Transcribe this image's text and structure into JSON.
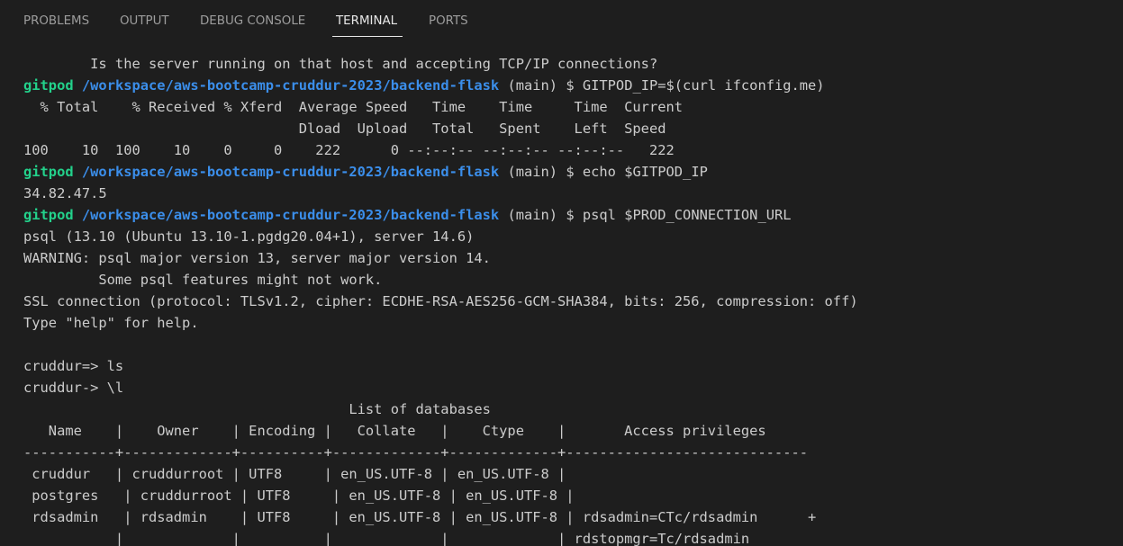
{
  "tabs": [
    {
      "label": "PROBLEMS",
      "active": false
    },
    {
      "label": "OUTPUT",
      "active": false
    },
    {
      "label": "DEBUG CONSOLE",
      "active": false
    },
    {
      "label": "TERMINAL",
      "active": true
    },
    {
      "label": "PORTS",
      "active": false
    }
  ],
  "colors": {
    "background": "#1e1e1e",
    "text": "#cccccc",
    "prompt_user": "#23d18b",
    "prompt_path": "#3b8eea",
    "tab_inactive": "#9d9d9d",
    "tab_active": "#e7e7e7"
  },
  "terminal": {
    "lines": [
      {
        "text": "        Is the server running on that host and accepting TCP/IP connections?"
      },
      {
        "prompt": {
          "user": "gitpod",
          "path": "/workspace/aws-bootcamp-cruddur-2023/backend-flask",
          "rest": " (main) $ GITPOD_IP=$(curl ifconfig.me)"
        }
      },
      {
        "text": "  % Total    % Received % Xferd  Average Speed   Time    Time     Time  Current"
      },
      {
        "text": "                                 Dload  Upload   Total   Spent    Left  Speed"
      },
      {
        "text": "100    10  100    10    0     0    222      0 --:--:-- --:--:-- --:--:--   222"
      },
      {
        "prompt": {
          "user": "gitpod",
          "path": "/workspace/aws-bootcamp-cruddur-2023/backend-flask",
          "rest": " (main) $ echo $GITPOD_IP"
        }
      },
      {
        "text": "34.82.47.5"
      },
      {
        "prompt": {
          "user": "gitpod",
          "path": "/workspace/aws-bootcamp-cruddur-2023/backend-flask",
          "rest": " (main) $ psql $PROD_CONNECTION_URL"
        }
      },
      {
        "text": "psql (13.10 (Ubuntu 13.10-1.pgdg20.04+1), server 14.6)"
      },
      {
        "text": "WARNING: psql major version 13, server major version 14."
      },
      {
        "text": "         Some psql features might not work."
      },
      {
        "text": "SSL connection (protocol: TLSv1.2, cipher: ECDHE-RSA-AES256-GCM-SHA384, bits: 256, compression: off)"
      },
      {
        "text": "Type \"help\" for help."
      },
      {
        "text": ""
      },
      {
        "text": "cruddur=> ls"
      },
      {
        "text": "cruddur-> \\l"
      },
      {
        "text": "                                       List of databases"
      },
      {
        "text": "   Name    |    Owner    | Encoding |   Collate   |    Ctype    |       Access privileges"
      },
      {
        "text": "-----------+-------------+----------+-------------+-------------+-----------------------------"
      },
      {
        "text": " cruddur   | cruddurroot | UTF8     | en_US.UTF-8 | en_US.UTF-8 |"
      },
      {
        "text": " postgres   | cruddurroot | UTF8     | en_US.UTF-8 | en_US.UTF-8 |"
      },
      {
        "text": " rdsadmin   | rdsadmin    | UTF8     | en_US.UTF-8 | en_US.UTF-8 | rdsadmin=CTc/rdsadmin      +"
      },
      {
        "text": "           |             |          |             |             | rdstopmgr=Tc/rdsadmin"
      }
    ]
  }
}
